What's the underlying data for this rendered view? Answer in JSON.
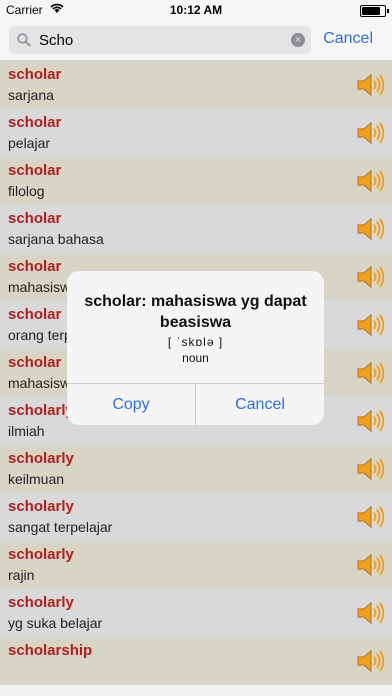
{
  "status": {
    "carrier": "Carrier",
    "time": "10:12 AM",
    "battery": 0.9
  },
  "search": {
    "value": "Scho",
    "cancel_label": "Cancel"
  },
  "rows": [
    {
      "word": "scholar",
      "meaning": "sarjana"
    },
    {
      "word": "scholar",
      "meaning": "pelajar"
    },
    {
      "word": "scholar",
      "meaning": "filolog"
    },
    {
      "word": "scholar",
      "meaning": "sarjana bahasa"
    },
    {
      "word": "scholar",
      "meaning": "mahasiswa"
    },
    {
      "word": "scholar",
      "meaning": "orang terpelajar"
    },
    {
      "word": "scholar",
      "meaning": "mahasiswa"
    },
    {
      "word": "scholarly",
      "meaning": "ilmiah"
    },
    {
      "word": "scholarly",
      "meaning": "keilmuan"
    },
    {
      "word": "scholarly",
      "meaning": "sangat terpelajar"
    },
    {
      "word": "scholarly",
      "meaning": "rajin"
    },
    {
      "word": "scholarly",
      "meaning": "yg suka belajar"
    },
    {
      "word": "scholarship",
      "meaning": ""
    }
  ],
  "dialog": {
    "title": "scholar: mahasiswa yg dapat beasiswa",
    "phonetic": "[ ˈskɒlə ]",
    "part_of_speech": "noun",
    "copy_label": "Copy",
    "cancel_label": "Cancel"
  },
  "colors": {
    "accent": "#2f6fe0",
    "word": "#b02020",
    "speaker": "#f0a020"
  }
}
